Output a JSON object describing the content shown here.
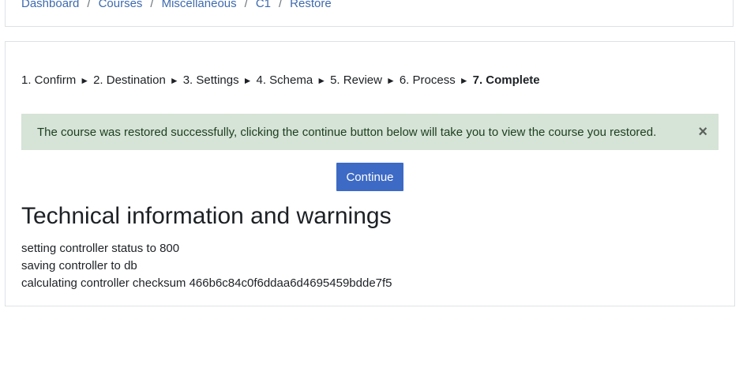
{
  "breadcrumb": {
    "items": [
      "Dashboard",
      "Courses",
      "Miscellaneous",
      "C1",
      "Restore"
    ],
    "separator": "/"
  },
  "steps": {
    "items": [
      "1. Confirm",
      "2. Destination",
      "3. Settings",
      "4. Schema",
      "5. Review",
      "6. Process",
      "7. Complete"
    ],
    "arrow": "►"
  },
  "alert": {
    "message": "The course was restored successfully, clicking the continue button below will take you to view the course you restored.",
    "close_glyph": "×"
  },
  "continue_button": {
    "label": "Continue"
  },
  "technical": {
    "heading": "Technical information and warnings",
    "lines": [
      "setting controller status to 800",
      "saving controller to db",
      "calculating controller checksum 466b6c84c0f6ddaa6d4695459bdde7f5"
    ]
  },
  "colors": {
    "link": "#3d6aaf",
    "button": "#3d6ac5",
    "alert_bg": "#d6e3d7"
  }
}
